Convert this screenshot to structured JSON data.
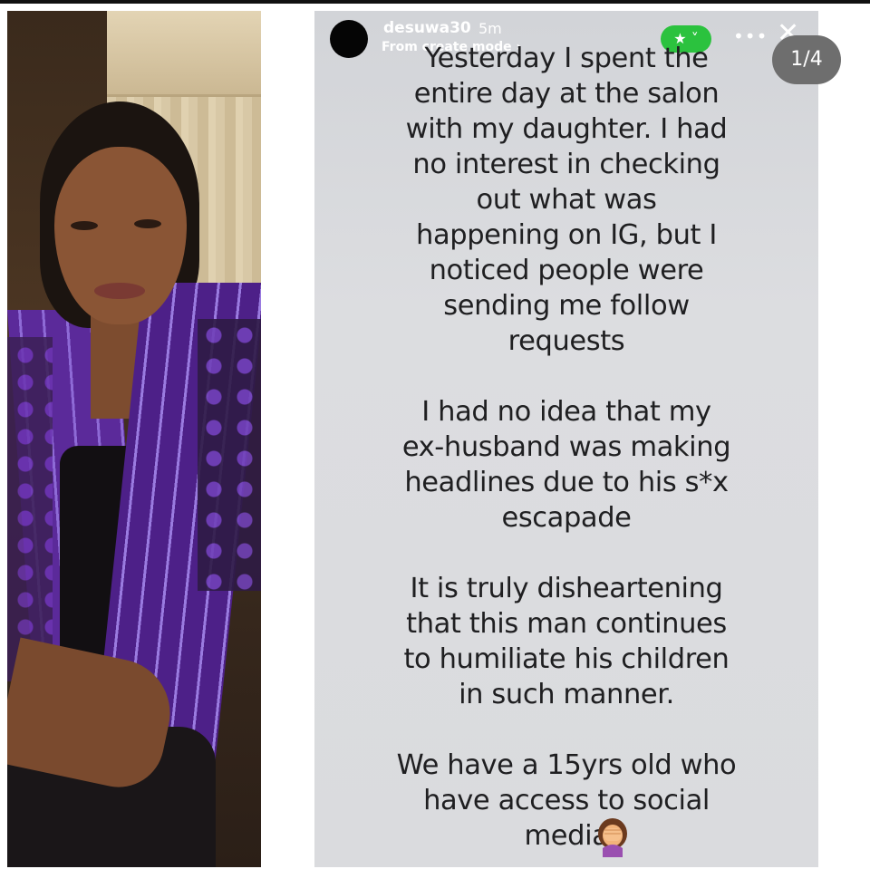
{
  "story": {
    "username": "desuwa30",
    "time_ago": "5m",
    "subtitle": "From create mode ›",
    "close_friends_icon": "★ ˅",
    "more_icon": "•••",
    "close_icon": "✕",
    "text": "Yesterday I spent the\nentire day at the salon\nwith my daughter. I had\nno interest in checking\nout what was\nhappening on IG, but I\nnoticed people were\nsending me follow\nrequests\n\nI had no idea that my\nex-husband was making\nheadlines due to his s*x\nescapade\n\nIt is truly disheartening\nthat this man continues\nto humiliate his children\nin such manner.\n\nWe have a 15yrs old who\nhave access to social\nmedia"
  },
  "page_counter": "1/4",
  "colors": {
    "accent_green": "#2bc23e",
    "story_background": "#d8d9dc",
    "counter_background": "#6e6e6e"
  },
  "icons": [
    "facepalm-emoji",
    "star-icon",
    "more-icon",
    "close-icon"
  ]
}
